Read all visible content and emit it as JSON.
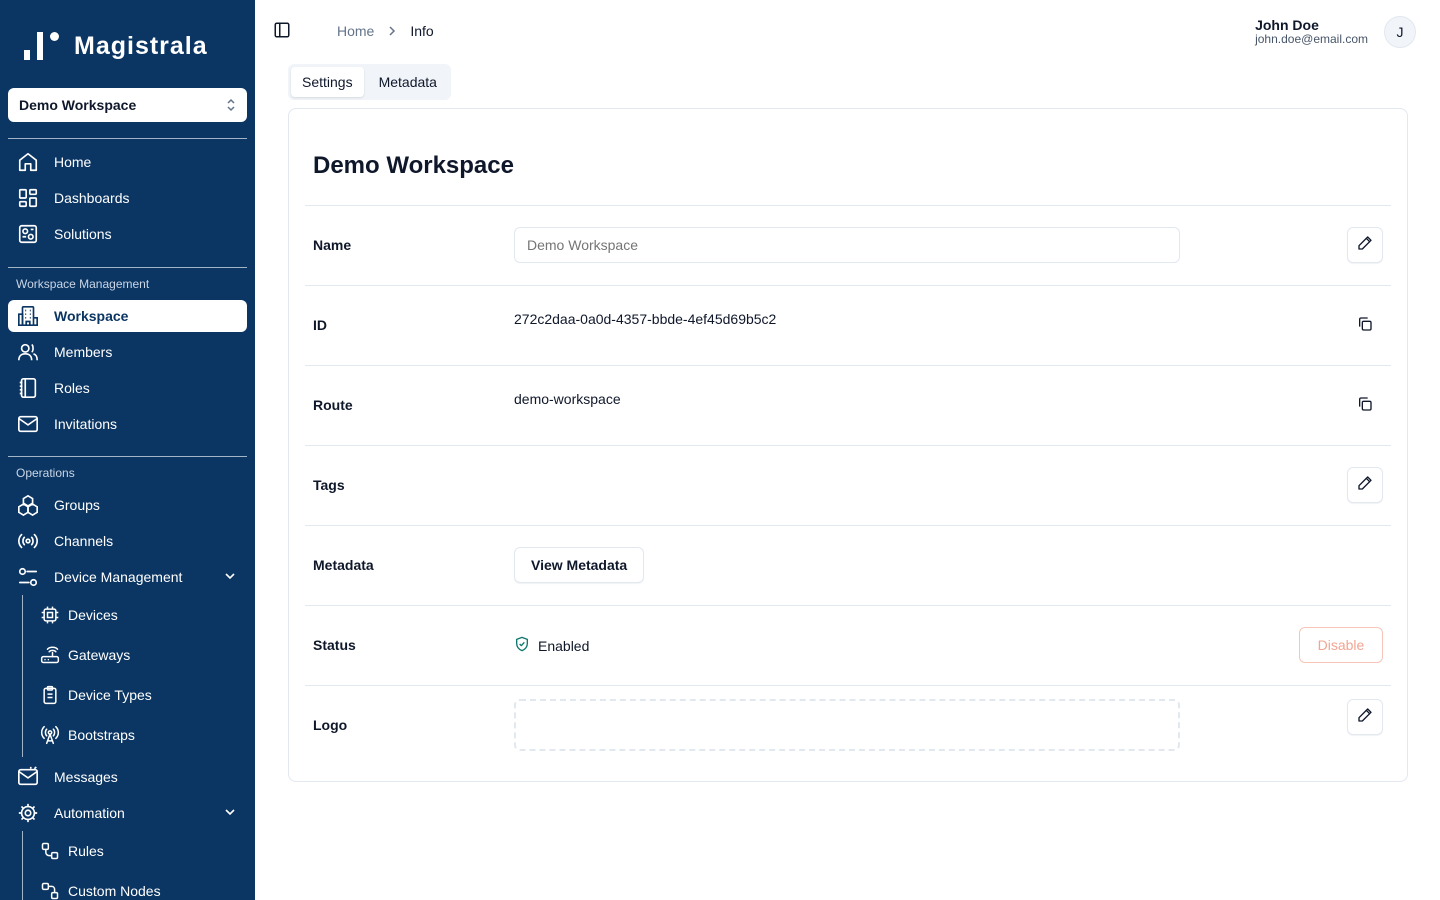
{
  "app": {
    "name": "Magistrala"
  },
  "workspace_selector": {
    "value": "Demo Workspace"
  },
  "nav": {
    "main": [
      {
        "label": "Home",
        "icon": "home-icon"
      },
      {
        "label": "Dashboards",
        "icon": "dashboards-icon"
      },
      {
        "label": "Solutions",
        "icon": "solutions-icon"
      }
    ],
    "workspace_management_label": "Workspace Management",
    "workspace_management": [
      {
        "label": "Workspace",
        "icon": "workspace-icon",
        "active": true
      },
      {
        "label": "Members",
        "icon": "members-icon"
      },
      {
        "label": "Roles",
        "icon": "roles-icon"
      },
      {
        "label": "Invitations",
        "icon": "mail-icon"
      }
    ],
    "operations_label": "Operations",
    "operations": [
      {
        "label": "Groups",
        "icon": "groups-icon"
      },
      {
        "label": "Channels",
        "icon": "channels-icon"
      },
      {
        "label": "Device Management",
        "icon": "device-management-icon",
        "expanded": true
      }
    ],
    "device_management": [
      {
        "label": "Devices",
        "icon": "chip-icon"
      },
      {
        "label": "Gateways",
        "icon": "router-icon"
      },
      {
        "label": "Device Types",
        "icon": "clipboard-icon"
      },
      {
        "label": "Bootstraps",
        "icon": "radio-tower-icon"
      }
    ],
    "more": [
      {
        "label": "Messages",
        "icon": "messages-icon"
      },
      {
        "label": "Automation",
        "icon": "cog-icon",
        "expanded": true
      }
    ],
    "automation": [
      {
        "label": "Rules",
        "icon": "workflow-icon"
      },
      {
        "label": "Custom Nodes",
        "icon": "workflow-icon"
      }
    ]
  },
  "header": {
    "breadcrumb": [
      "Home",
      "Info"
    ],
    "user": {
      "name": "John Doe",
      "email": "john.doe@email.com",
      "initial": "J"
    }
  },
  "tabs": [
    {
      "label": "Settings",
      "active": true
    },
    {
      "label": "Metadata",
      "active": false
    }
  ],
  "card": {
    "title": "Demo Workspace",
    "fields": {
      "name": {
        "label": "Name",
        "placeholder": "Demo Workspace"
      },
      "id": {
        "label": "ID",
        "value": "272c2daa-0a0d-4357-bbde-4ef45d69b5c2"
      },
      "route": {
        "label": "Route",
        "value": "demo-workspace"
      },
      "tags": {
        "label": "Tags"
      },
      "metadata": {
        "label": "Metadata",
        "button": "View Metadata"
      },
      "status": {
        "label": "Status",
        "value": "Enabled",
        "action": "Disable"
      },
      "logo": {
        "label": "Logo"
      }
    }
  },
  "colors": {
    "sidebar_bg": "#0b3562",
    "status_enabled": "#0f766e",
    "disable_button": "#f2a593"
  }
}
